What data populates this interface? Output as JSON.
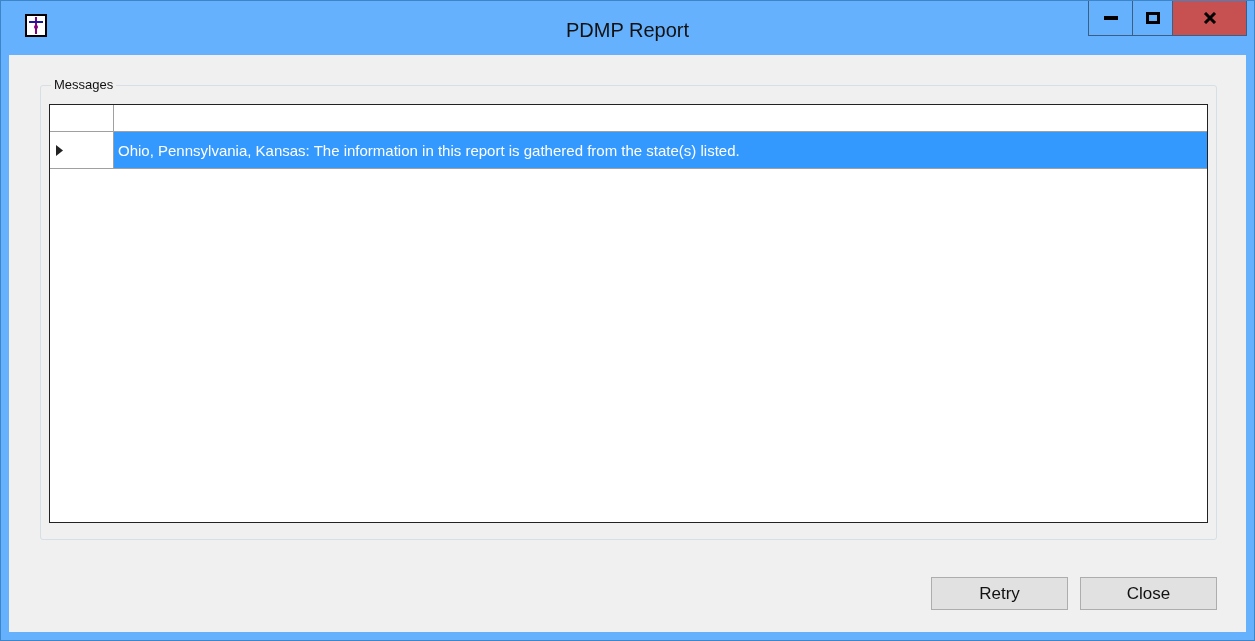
{
  "window": {
    "title": "PDMP Report"
  },
  "group": {
    "label": "Messages"
  },
  "table": {
    "rows": [
      {
        "text": "Ohio, Pennsylvania, Kansas: The information in this report is gathered from the state(s) listed.",
        "selected": true
      }
    ]
  },
  "buttons": [
    "Retry",
    "Close"
  ]
}
